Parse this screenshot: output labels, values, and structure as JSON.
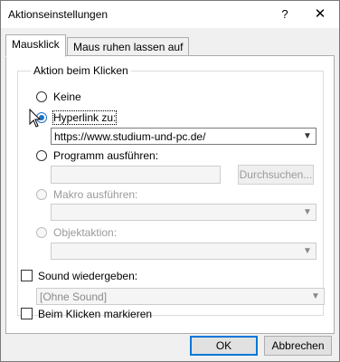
{
  "window": {
    "title": "Aktionseinstellungen",
    "help_icon": "question-mark-icon",
    "close_icon": "close-icon"
  },
  "tabs": [
    {
      "label": "Mausklick",
      "active": true
    },
    {
      "label": "Maus ruhen lassen auf",
      "active": false
    }
  ],
  "group": {
    "title": "Aktion beim Klicken",
    "options": {
      "none": {
        "label": "Keine",
        "checked": false,
        "enabled": true
      },
      "hyperlink": {
        "label": "Hyperlink zu:",
        "checked": true,
        "enabled": true
      },
      "program": {
        "label": "Programm ausführen:",
        "checked": false,
        "enabled": true
      },
      "macro": {
        "label": "Makro ausführen:",
        "checked": false,
        "enabled": false
      },
      "object": {
        "label": "Objektaktion:",
        "checked": false,
        "enabled": false
      }
    },
    "hyperlink_value": "https://www.studium-und-pc.de/",
    "program_value": "",
    "browse_button": "Durchsuchen...",
    "macro_value": "",
    "object_value": ""
  },
  "sound": {
    "label": "Sound wiedergeben:",
    "checked": false,
    "value": "[Ohne Sound]"
  },
  "highlight": {
    "label": "Beim Klicken markieren",
    "checked": false
  },
  "footer": {
    "ok": "OK",
    "cancel": "Abbrechen"
  },
  "colors": {
    "accent": "#0078d7",
    "radio_checked": "#1e73c8"
  }
}
